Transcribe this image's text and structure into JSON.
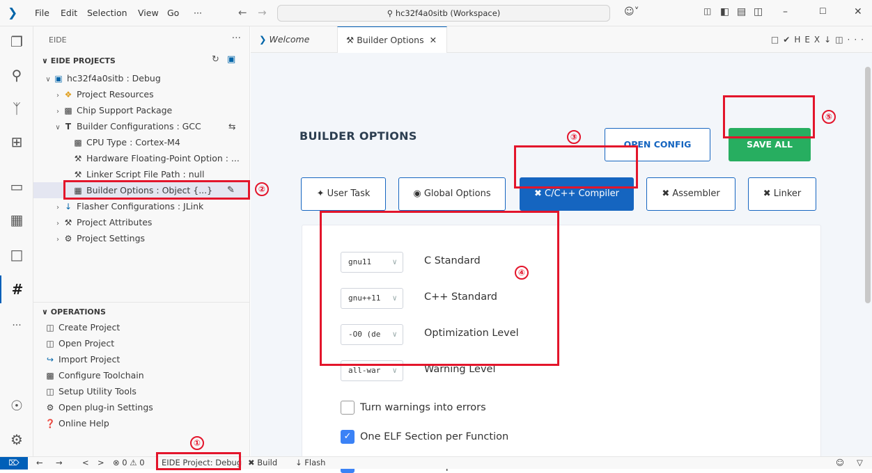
{
  "titlebar": {
    "menu": [
      "File",
      "Edit",
      "Selection",
      "View",
      "Go",
      "···"
    ],
    "search_text": "hc32f4a0sitb (Workspace)"
  },
  "sidebar": {
    "header": "EIDE",
    "projects_title": "EIDE PROJECTS",
    "tree": [
      {
        "label": "hc32f4a0sitb : Debug",
        "icon": "project-icon",
        "chev": "∨"
      },
      {
        "label": "Project Resources",
        "icon": "resources-icon",
        "chev": "›"
      },
      {
        "label": "Chip Support Package",
        "icon": "chip-icon",
        "chev": "›"
      },
      {
        "label": "Builder Configurations : GCC",
        "icon": "hammer-icon",
        "chev": "∨"
      },
      {
        "label": "CPU Type : Cortex-M4",
        "icon": "cpu-icon",
        "chev": ""
      },
      {
        "label": "Hardware Floating-Point Option : ...",
        "icon": "wrench-icon",
        "chev": ""
      },
      {
        "label": "Linker Script File Path : null",
        "icon": "wrench-icon",
        "chev": ""
      },
      {
        "label": "Builder Options : Object {...}",
        "icon": "options-icon",
        "chev": ""
      },
      {
        "label": "Flasher Configurations : JLink",
        "icon": "flash-icon",
        "chev": "›"
      },
      {
        "label": "Project Attributes",
        "icon": "wrench-icon",
        "chev": "›"
      },
      {
        "label": "Project Settings",
        "icon": "gear-icon",
        "chev": "›"
      }
    ],
    "operations_title": "OPERATIONS",
    "operations": [
      {
        "label": "Create Project",
        "icon": "create-icon"
      },
      {
        "label": "Open Project",
        "icon": "open-icon"
      },
      {
        "label": "Import Project",
        "icon": "import-icon"
      },
      {
        "label": "Configure Toolchain",
        "icon": "toolchain-icon"
      },
      {
        "label": "Setup Utility Tools",
        "icon": "tools-icon"
      },
      {
        "label": "Open plug-in Settings",
        "icon": "gear-icon"
      },
      {
        "label": "Online Help",
        "icon": "help-icon"
      }
    ]
  },
  "tabs": {
    "welcome": "Welcome",
    "builder": "Builder Options",
    "right_icons": "HEX"
  },
  "builder": {
    "title": "BUILDER OPTIONS",
    "open_config": "OPEN CONFIG",
    "save_all": "SAVE ALL",
    "option_tabs": [
      "User Task",
      "Global Options",
      "C/C++ Compiler",
      "Assembler",
      "Linker"
    ],
    "selects": [
      {
        "value": "gnu11",
        "label": "C Standard"
      },
      {
        "value": "gnu++11",
        "label": "C++ Standard"
      },
      {
        "value": "-O0 (de",
        "label": "Optimization Level"
      },
      {
        "value": "all-war",
        "label": "Warning Level"
      }
    ],
    "checkboxes": [
      {
        "label": "Turn warnings into errors",
        "checked": false
      },
      {
        "label": "One ELF Section per Function",
        "checked": true
      },
      {
        "label": "One ELF Section per Data",
        "checked": true
      }
    ]
  },
  "annotations": [
    "①",
    "②",
    "③",
    "④",
    "⑤"
  ],
  "statusbar": {
    "problems": "⊗ 0 ⚠ 0",
    "project": "EIDE Project: Debug",
    "build": "Build",
    "flash": "Flash"
  },
  "colors": {
    "accent": "#1565c0",
    "save": "#27ae60",
    "highlight": "#e3152b"
  }
}
